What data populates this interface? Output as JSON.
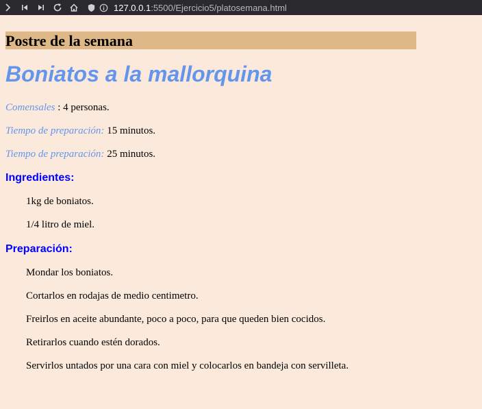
{
  "browser": {
    "url_host": "127.0.0.1",
    "url_rest": ":5500/Ejercicio5/platosemana.html"
  },
  "page": {
    "banner": "Postre de la semana",
    "dish_name": "Boniatos a la mallorquina",
    "info": [
      {
        "label": "Comensales",
        "sep": " : ",
        "value": "4 personas."
      },
      {
        "label": "Tiempo de preparación:",
        "sep": " ",
        "value": "15 minutos."
      },
      {
        "label": "Tiempo de preparación:",
        "sep": " ",
        "value": "25 minutos."
      }
    ],
    "ingredients_title": "Ingredientes:",
    "ingredients": [
      "1kg de boniatos.",
      "1/4 litro de miel."
    ],
    "preparation_title": "Preparación:",
    "steps": [
      "Mondar los boniatos.",
      "Cortarlos en rodajas de medio centimetro.",
      "Freirlos en aceite abundante, poco a poco, para que queden bien cocidos.",
      "Retirarlos cuando estén dorados.",
      "Servirlos untados por una cara con miel y colocarlos en bandeja con servilleta."
    ]
  },
  "icons": [
    "chevron-right-icon",
    "back-icon",
    "forward-icon",
    "reload-icon",
    "home-icon",
    "shield-icon",
    "info-icon"
  ]
}
